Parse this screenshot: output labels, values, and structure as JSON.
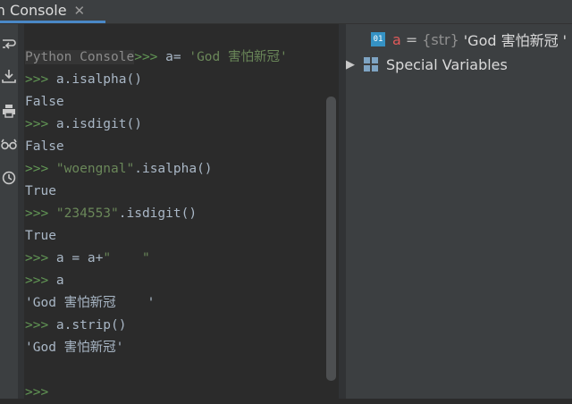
{
  "tab": {
    "title": "on Console",
    "close": "✕"
  },
  "toolbar": [
    {
      "icon": "soft-wrap-icon"
    },
    {
      "icon": "scroll-to-end-icon"
    },
    {
      "icon": "print-icon"
    },
    {
      "icon": "show-variables-icon"
    },
    {
      "icon": "history-icon"
    }
  ],
  "console": {
    "banner": "Python Console",
    "lines": [
      {
        "prompt": ">>> ",
        "code": "a= ",
        "str": "'God 害怕新冠'"
      },
      {
        "prompt": ">>> ",
        "code": "a.isalpha()"
      },
      {
        "out": "False"
      },
      {
        "prompt": ">>> ",
        "code": "a.isdigit()"
      },
      {
        "out": "False"
      },
      {
        "prompt": ">>> ",
        "str": "\"woengnal\"",
        "code2": ".isalpha()"
      },
      {
        "out": "True"
      },
      {
        "prompt": ">>> ",
        "str": "\"234553\"",
        "code2": ".isdigit()"
      },
      {
        "out": "True"
      },
      {
        "prompt": ">>> ",
        "code": "a = a+",
        "str": "\"    \""
      },
      {
        "prompt": ">>> ",
        "code": "a"
      },
      {
        "out": "'God 害怕新冠    '"
      },
      {
        "prompt": ">>> ",
        "code": "a.strip()"
      },
      {
        "out": "'God 害怕新冠'"
      },
      {
        "out": ""
      },
      {
        "prompt": ">>>"
      }
    ]
  },
  "variables": {
    "items": [
      {
        "icon_text": "01",
        "name": "a",
        "eq": "=",
        "type": "{str}",
        "value": "'God 害怕新冠  '"
      },
      {
        "label": "Special Variables"
      }
    ]
  },
  "colors": {
    "prompt": "#629755",
    "string": "#6a8759",
    "accent": "#4a88c7"
  }
}
